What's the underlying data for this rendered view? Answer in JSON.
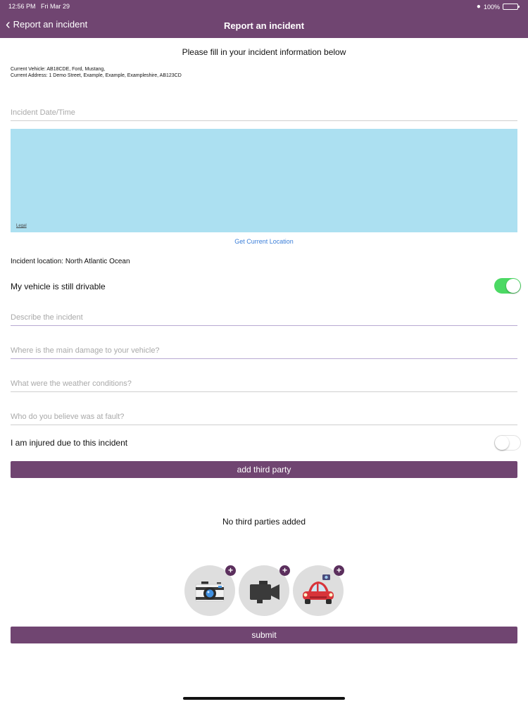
{
  "status_bar": {
    "time": "12:56 PM",
    "date": "Fri Mar 29",
    "battery": "100%"
  },
  "nav": {
    "back_label": "Report an incident",
    "title": "Report an incident"
  },
  "intro": "Please fill in your incident information below",
  "vehicle": {
    "current_vehicle": "Current Vehicle: AB18CDE, Ford, Mustang,",
    "current_address": "Current Address: 1 Demo Street, Example, Example, Exampleshire, AB123CD"
  },
  "fields": {
    "date_time": {
      "placeholder": "Incident Date/Time",
      "value": ""
    },
    "describe": {
      "placeholder": "Describe the incident",
      "value": ""
    },
    "damage": {
      "placeholder": "Where is the main damage to your vehicle?",
      "value": ""
    },
    "weather": {
      "placeholder": "What were the weather conditions?",
      "value": ""
    },
    "fault": {
      "placeholder": "Who do you believe was at fault?",
      "value": ""
    }
  },
  "map": {
    "legal": "Legal",
    "get_location": "Get Current Location"
  },
  "incident_location": "Incident location: North Atlantic Ocean",
  "toggles": {
    "drivable": {
      "label": "My vehicle is still drivable",
      "on": true
    },
    "injured": {
      "label": "I am injured due to this incident",
      "on": false
    }
  },
  "buttons": {
    "add_third_party": "add third party",
    "submit": "submit",
    "add": "+"
  },
  "third_parties": {
    "empty": "No third parties added"
  },
  "media": [
    {
      "name": "camera",
      "icon": "camera-icon"
    },
    {
      "name": "video",
      "icon": "video-camera-icon"
    },
    {
      "name": "vehicle",
      "icon": "car-icon"
    }
  ],
  "colors": {
    "brand": "#704571",
    "toggle_on": "#4cd964",
    "link": "#3a7ed8",
    "map": "#ace0f1"
  }
}
